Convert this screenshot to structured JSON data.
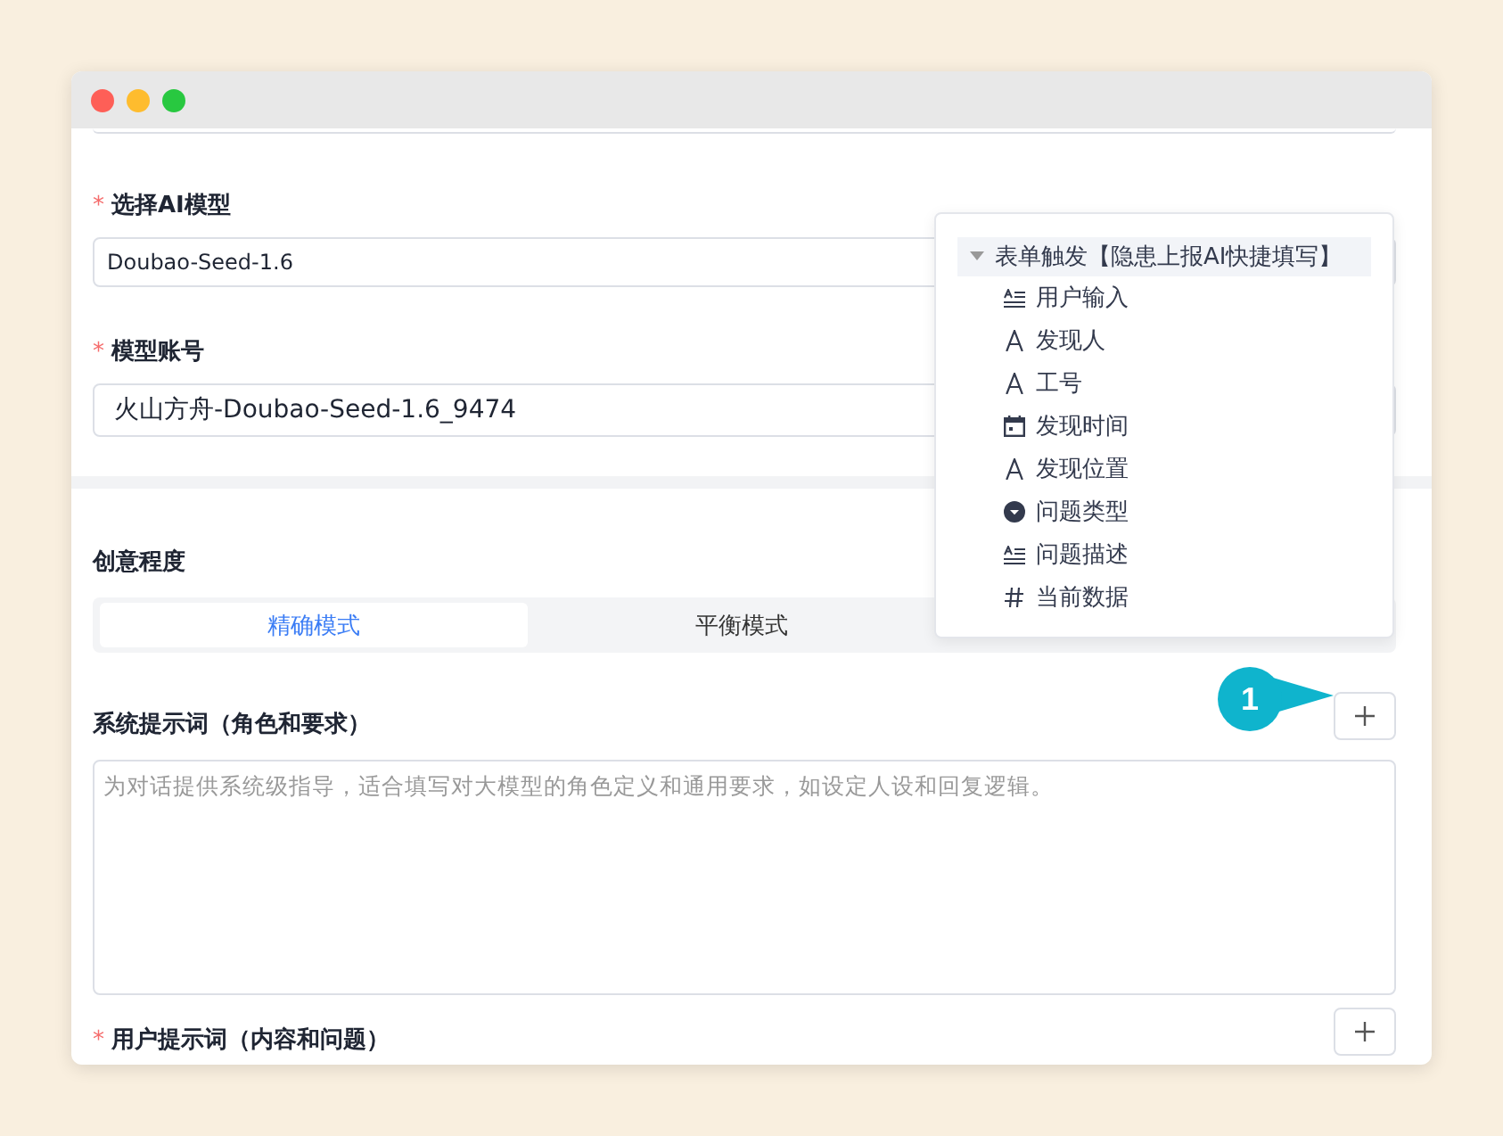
{
  "fields": [
    {
      "label": "选择AI模型",
      "required_mark": "*",
      "value": "Doubao-Seed-1.6"
    },
    {
      "label": "模型账号",
      "required_mark": "*",
      "value": "火山方舟-Doubao-Seed-1.6_9474"
    }
  ],
  "creativity": {
    "label": "创意程度",
    "options": [
      {
        "label": "精确模式",
        "selected": true
      },
      {
        "label": "平衡模式",
        "selected": false
      }
    ]
  },
  "system_prompt": {
    "label": "系统提示词（角色和要求）",
    "placeholder": "为对话提供系统级指导，适合填写对大模型的角色定义和通用要求，如设定人设和回复逻辑。"
  },
  "user_prompt": {
    "label": "用户提示词（内容和问题）",
    "required_mark": "*"
  },
  "variable_popup": {
    "group": {
      "label": "表单触发【隐患上报AI快捷填写】",
      "expanded": true
    },
    "items": [
      {
        "label": "用户输入",
        "kind": "multiline"
      },
      {
        "label": "发现人",
        "kind": "text"
      },
      {
        "label": "工号",
        "kind": "text"
      },
      {
        "label": "发现时间",
        "kind": "date"
      },
      {
        "label": "发现位置",
        "kind": "text"
      },
      {
        "label": "问题类型",
        "kind": "select"
      },
      {
        "label": "问题描述",
        "kind": "multiline"
      },
      {
        "label": "当前数据",
        "kind": "number"
      }
    ]
  },
  "callout": {
    "number": "1"
  }
}
